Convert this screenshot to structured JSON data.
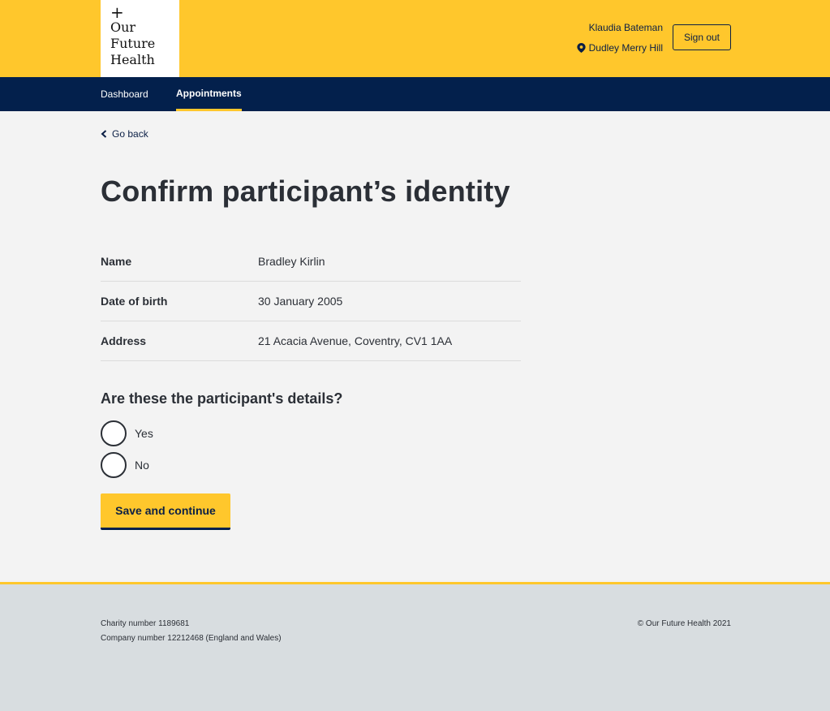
{
  "header": {
    "logo": {
      "symbol": "+",
      "line1": "Our",
      "line2": "Future",
      "line3": "Health"
    },
    "user_name": "Klaudia Bateman",
    "location": "Dudley Merry Hill",
    "location_icon": "map-pin-icon",
    "signout_label": "Sign out"
  },
  "nav": {
    "items": [
      {
        "label": "Dashboard",
        "active": false
      },
      {
        "label": "Appointments",
        "active": true
      }
    ]
  },
  "main": {
    "back_label": "Go back",
    "title": "Confirm participant’s identity",
    "details": [
      {
        "label": "Name",
        "value": "Bradley Kirlin"
      },
      {
        "label": "Date of birth",
        "value": "30 January 2005"
      },
      {
        "label": "Address",
        "value": "21 Acacia Avenue, Coventry, CV1 1AA"
      }
    ],
    "question": "Are these the participant's details?",
    "options": [
      "Yes",
      "No"
    ],
    "submit_label": "Save and continue"
  },
  "footer": {
    "charity": "Charity number 1189681",
    "company": "Company number 12212468 (England and Wales)",
    "copyright": "© Our Future Health 2021"
  },
  "colors": {
    "brand_yellow": "#ffc72c",
    "navy": "#03204c",
    "page_bg": "#f3f3f3",
    "footer_bg": "#d8dde0"
  }
}
